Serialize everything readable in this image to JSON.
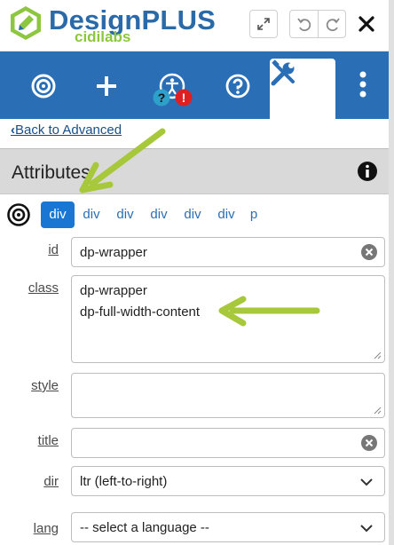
{
  "header": {
    "brand_name": "DesignPLUS",
    "brand_sub": "cidilabs",
    "icons": [
      "logo-icon",
      "expand-icon",
      "undo-icon",
      "redo-icon",
      "close-icon"
    ]
  },
  "toolbar": {
    "items": [
      {
        "name": "target-icon"
      },
      {
        "name": "plus-icon"
      },
      {
        "name": "accessibility-icon",
        "badges": [
          "?",
          "!"
        ]
      },
      {
        "name": "help-icon"
      },
      {
        "name": "tools-icon",
        "active": true
      },
      {
        "name": "more-vertical-icon"
      }
    ],
    "color": "#2a6fb5"
  },
  "back_link": "Back to Advanced",
  "attributes": {
    "title": "Attributes"
  },
  "element_path": [
    "div",
    "div",
    "div",
    "div",
    "div",
    "div",
    "p"
  ],
  "form": {
    "id": {
      "label": "id",
      "value": "dp-wrapper"
    },
    "class": {
      "label": "class",
      "lines": [
        "dp-wrapper",
        "dp-full-width-content"
      ]
    },
    "style": {
      "label": "style",
      "value": ""
    },
    "title": {
      "label": "title",
      "value": ""
    },
    "dir": {
      "label": "dir",
      "value": "ltr (left-to-right)"
    },
    "lang": {
      "label": "lang",
      "value": "-- select a language --"
    }
  },
  "colors": {
    "accent": "#1976d2",
    "annotation_arrow": "#a7c83b",
    "brand_green": "#8dc63f",
    "brand_blue": "#2b6aa8"
  }
}
